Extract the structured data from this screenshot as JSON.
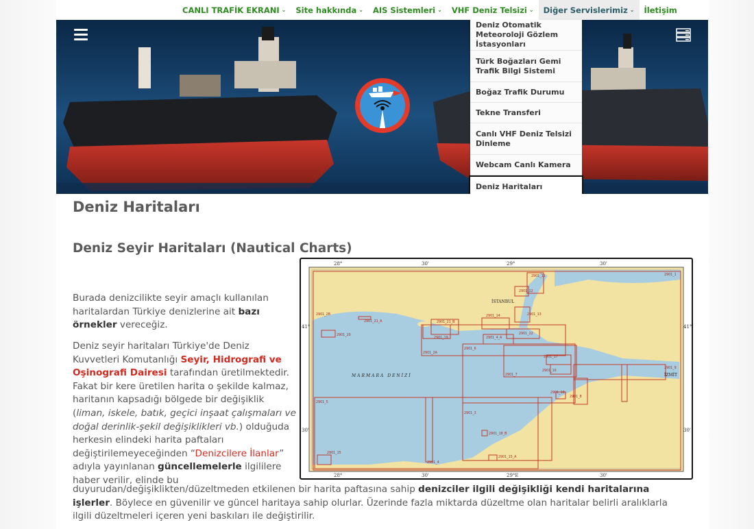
{
  "nav": {
    "items": [
      {
        "label": "CANLI TRAFİK EKRANI",
        "has_caret": true
      },
      {
        "label": "Site hakkında",
        "has_caret": true
      },
      {
        "label": "AIS Sistemleri",
        "has_caret": true
      },
      {
        "label": "VHF Deniz Telsizi",
        "has_caret": true
      },
      {
        "label": "Diğer Servislerimiz",
        "has_caret": true
      },
      {
        "label": "İletişim",
        "has_caret": false
      }
    ],
    "caret": "⌄"
  },
  "dropdown": {
    "items": [
      {
        "label": "Deniz Otomatik Meteoroloji Gözlem İstasyonları"
      },
      {
        "label": "Türk Boğazları Gemi Trafik Bilgi Sistemi"
      },
      {
        "label": "Boğaz Trafik Durumu"
      },
      {
        "label": "Tekne Transferi"
      },
      {
        "label": "Canlı VHF Deniz Telsizi Dinleme"
      },
      {
        "label": "Webcam Canlı Kamera"
      },
      {
        "label": "Deniz Haritaları"
      }
    ]
  },
  "page": {
    "title": "Deniz Haritaları",
    "subtitle": "Deniz Seyir Haritaları (Nautical Charts)"
  },
  "para1": {
    "t1": "Burada denizcilikte seyir amaçlı kullanılan haritalardan Türkiye denizlerine ait ",
    "b1": "bazı örnekler",
    "t2": " vereceğiz."
  },
  "para2": {
    "t1": "Deniz seyir haritaları Türkiye'de Deniz Kuvvetleri Komutanlığı ",
    "link1": "Seyir, Hidrografi ve Oşinografi Dairesi",
    "t2": " tarafından üretilmektedir. Fakat bir kere üretilen harita o şekilde kalmaz, haritanın kapsadığı bölgede bir değişiklik (",
    "i1": "liman, iskele, batık, geçici inşaat çalışmaları ve doğal derinlik-şekil değişiklikleri vb.",
    "t3": ") olduğuda herkesin elindeki harita paftaları değiştirilemeyeceğinden “",
    "link2": "Denizcilere İlanlar",
    "t4": "” adıyla yayınlanan ",
    "b1": "güncellemelerle",
    "t5": " ilgililere haber verilir, elinde bu"
  },
  "para3": {
    "t1": "duyurudan/değişiklikten/düzeltmeden etkilenen bir harita paftasına sahip ",
    "b1": "denizciler ilgili değişikliği kendi haritalarına işlerler",
    "t2": ". Böylece en güvenilir ve güncel haritaya sahip olurlar. Üzerinde fazla miktarda düzeltme olan haritalar belirli aralıklarla ilgili düzeltmeleri içeren yeni baskıları ile değiştirilir."
  },
  "map": {
    "top_ticks": [
      "28°",
      "30'",
      "29°",
      "30'"
    ],
    "bottom_ticks": [
      "28°",
      "30'",
      "29°E",
      "30'"
    ],
    "left_ticks": [
      "41°",
      "30'"
    ],
    "right_ticks": [
      "41°",
      "30'"
    ],
    "place_labels": [
      "İSTANBUL",
      "MARMARA DENİZİ",
      "İZMİT"
    ],
    "chart_ids": [
      "2901_1",
      "2901_11",
      "2901_12",
      "2901_13",
      "2901_14",
      "2901_21_A",
      "2901_21_B",
      "2901_2B",
      "2901_20",
      "2901_19",
      "2901_22",
      "2901_4_A",
      "2901_6",
      "2901_2A",
      "2901_7",
      "2901_17",
      "2901_16",
      "2901_9",
      "2901_18",
      "2901_8",
      "2901_5",
      "2901_3",
      "2901_18_B",
      "2901_15_A",
      "2901_15",
      "2901_4"
    ]
  },
  "colors": {
    "nav_green": "#2e8b20",
    "text_gray": "#555555",
    "link_red": "#d22a1f",
    "sea": "#a9cde0",
    "land": "#f3e3a2",
    "chart_red": "#c23a2a"
  },
  "icons": [
    "hamburger-menu-icon",
    "server-stack-icon",
    "site-logo"
  ]
}
